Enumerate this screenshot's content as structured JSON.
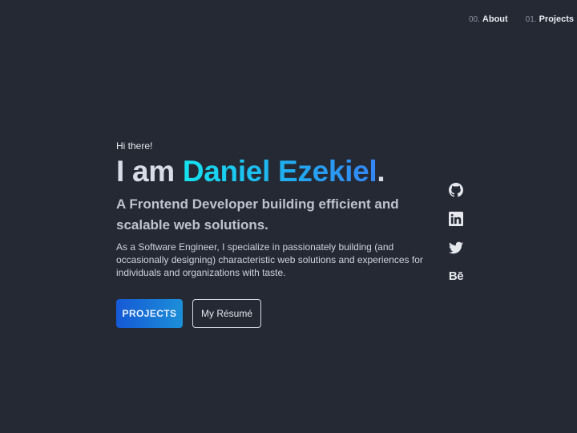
{
  "nav": {
    "items": [
      {
        "num": "00.",
        "label": "About"
      },
      {
        "num": "01.",
        "label": "Projects"
      }
    ]
  },
  "hero": {
    "greeting": "Hi there!",
    "headline_prefix": "I am ",
    "name": "Daniel Ezekiel",
    "headline_suffix": ".",
    "tagline": "A Frontend Developer building efficient and scalable web solutions.",
    "bio": "As a Software Engineer, I specialize in passionately building (and occasionally designing) characteristic web solutions and experiences for individuals and organizations with taste.",
    "primary_button": "PROJECTS",
    "secondary_button": "My Résumé"
  },
  "socials": {
    "icons": [
      "github-icon",
      "linkedin-icon",
      "twitter-icon",
      "behance-icon"
    ],
    "behance_glyph": "Bē"
  },
  "colors": {
    "background": "#252934",
    "accent_start": "#15e2ef",
    "accent_end": "#3486f5",
    "primary_button_start": "#1559d6",
    "primary_button_end": "#1c8fd8"
  }
}
